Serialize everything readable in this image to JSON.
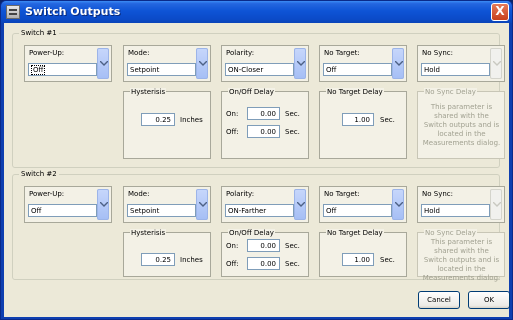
{
  "window": {
    "title": "Switch Outputs",
    "close": "X"
  },
  "switches": [
    {
      "title": "Switch #1",
      "power_up": {
        "label": "Power-Up:",
        "value": "Off"
      },
      "mode": {
        "label": "Mode:",
        "value": "Setpoint"
      },
      "polarity": {
        "label": "Polarity:",
        "value": "ON-Closer"
      },
      "no_target": {
        "label": "No Target:",
        "value": "Off"
      },
      "no_sync": {
        "label": "No Sync:",
        "value": "Hold"
      },
      "hysterisis": {
        "label": "Hysterisis",
        "value": "0.25",
        "unit": "Inches"
      },
      "onoff_delay": {
        "label": "On/Off Delay",
        "on_label": "On:",
        "on_value": "0.00",
        "off_label": "Off:",
        "off_value": "0.00",
        "unit": "Sec."
      },
      "no_target_delay": {
        "label": "No Target Delay",
        "value": "1.00",
        "unit": "Sec."
      },
      "no_sync_delay": {
        "label": "No Sync Delay",
        "note": "This parameter is shared with the Switch outputs and is located in the Measurements dialog."
      }
    },
    {
      "title": "Switch #2",
      "power_up": {
        "label": "Power-Up:",
        "value": "Off"
      },
      "mode": {
        "label": "Mode:",
        "value": "Setpoint"
      },
      "polarity": {
        "label": "Polarity:",
        "value": "ON-Farther"
      },
      "no_target": {
        "label": "No Target:",
        "value": "Off"
      },
      "no_sync": {
        "label": "No Sync:",
        "value": "Hold"
      },
      "hysterisis": {
        "label": "Hysterisis",
        "value": "0.25",
        "unit": "Inches"
      },
      "onoff_delay": {
        "label": "On/Off Delay",
        "on_label": "On:",
        "on_value": "0.00",
        "off_label": "Off:",
        "off_value": "0.00",
        "unit": "Sec."
      },
      "no_target_delay": {
        "label": "No Target Delay",
        "value": "1.00",
        "unit": "Sec."
      },
      "no_sync_delay": {
        "label": "No Sync Delay",
        "note": "This parameter is shared with the Switch outputs and is located in the Measurements dialog."
      }
    }
  ],
  "buttons": {
    "cancel": "Cancel",
    "ok": "OK"
  }
}
